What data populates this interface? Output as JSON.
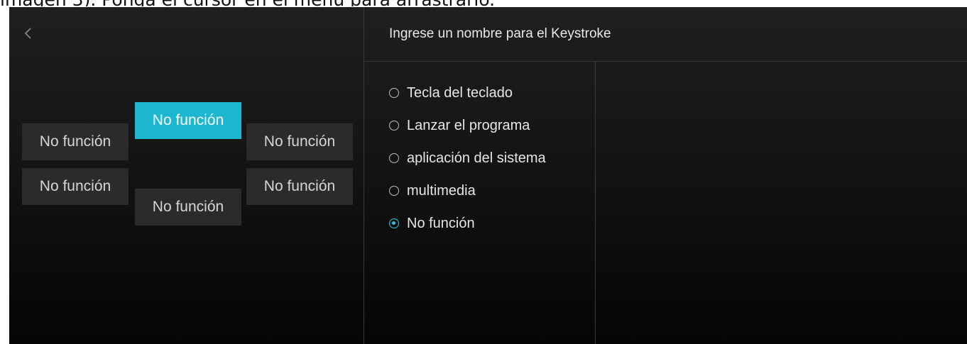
{
  "document": {
    "caption": "imagen 3). Ponga el cursor en el menú para arrastrarlo."
  },
  "header": {
    "back_icon": "chevron-left-icon",
    "title": "Ingrese un nombre para el Keystroke"
  },
  "key_layout": {
    "selected_index": 0,
    "keys": [
      {
        "label": "No función",
        "state": "selected"
      },
      {
        "label": "No función",
        "state": "normal"
      },
      {
        "label": "No función",
        "state": "normal"
      },
      {
        "label": "No función",
        "state": "normal"
      },
      {
        "label": "No función",
        "state": "normal"
      },
      {
        "label": "No función",
        "state": "normal"
      }
    ]
  },
  "function_options": {
    "selected": "No función",
    "items": [
      {
        "label": "Tecla del teclado",
        "checked": false
      },
      {
        "label": "Lanzar el programa",
        "checked": false
      },
      {
        "label": "aplicación del sistema",
        "checked": false
      },
      {
        "label": "multimedia",
        "checked": false
      },
      {
        "label": "No función",
        "checked": true
      }
    ]
  },
  "colors": {
    "accent": "#1bb6cf",
    "button_bg": "#2b2b2b",
    "panel_bg": "#1a1a1a",
    "divider": "#3a3a3a"
  }
}
